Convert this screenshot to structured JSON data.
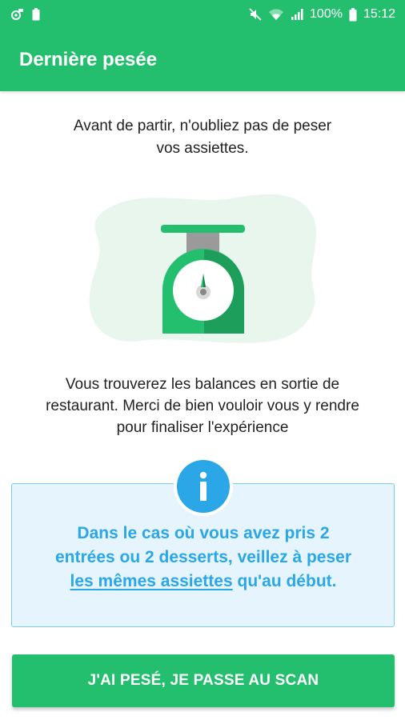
{
  "status_bar": {
    "icons": [
      "settings-bug-icon",
      "battery-small-icon",
      "mute-icon",
      "wifi-icon",
      "signal-icon",
      "battery-icon"
    ],
    "battery": "100%",
    "time": "15:12"
  },
  "app_bar": {
    "title": "Dernière pesée"
  },
  "intro": {
    "line1": "Avant de partir, n'oubliez pas de peser",
    "line2": "vos assiettes."
  },
  "body": {
    "line1": "Vous trouverez les balances en sortie de",
    "line2": "restaurant. Merci de bien vouloir vous y rendre",
    "line3": "pour finaliser l'expérience"
  },
  "info": {
    "icon": "info-icon",
    "line1": "Dans le cas où vous avez pris 2",
    "line2": "entrées ou 2 desserts, veillez à peser",
    "link": "les mêmes assiettes",
    "line3_rest": " qu'au début."
  },
  "cta": {
    "label": "J'AI PESÉ, JE PASSE AU SCAN"
  },
  "colors": {
    "primary": "#24bf6e",
    "info_blue": "#2ba6e6",
    "info_bg": "#e5f4fd",
    "illustration_blob": "#e8f6ee"
  }
}
